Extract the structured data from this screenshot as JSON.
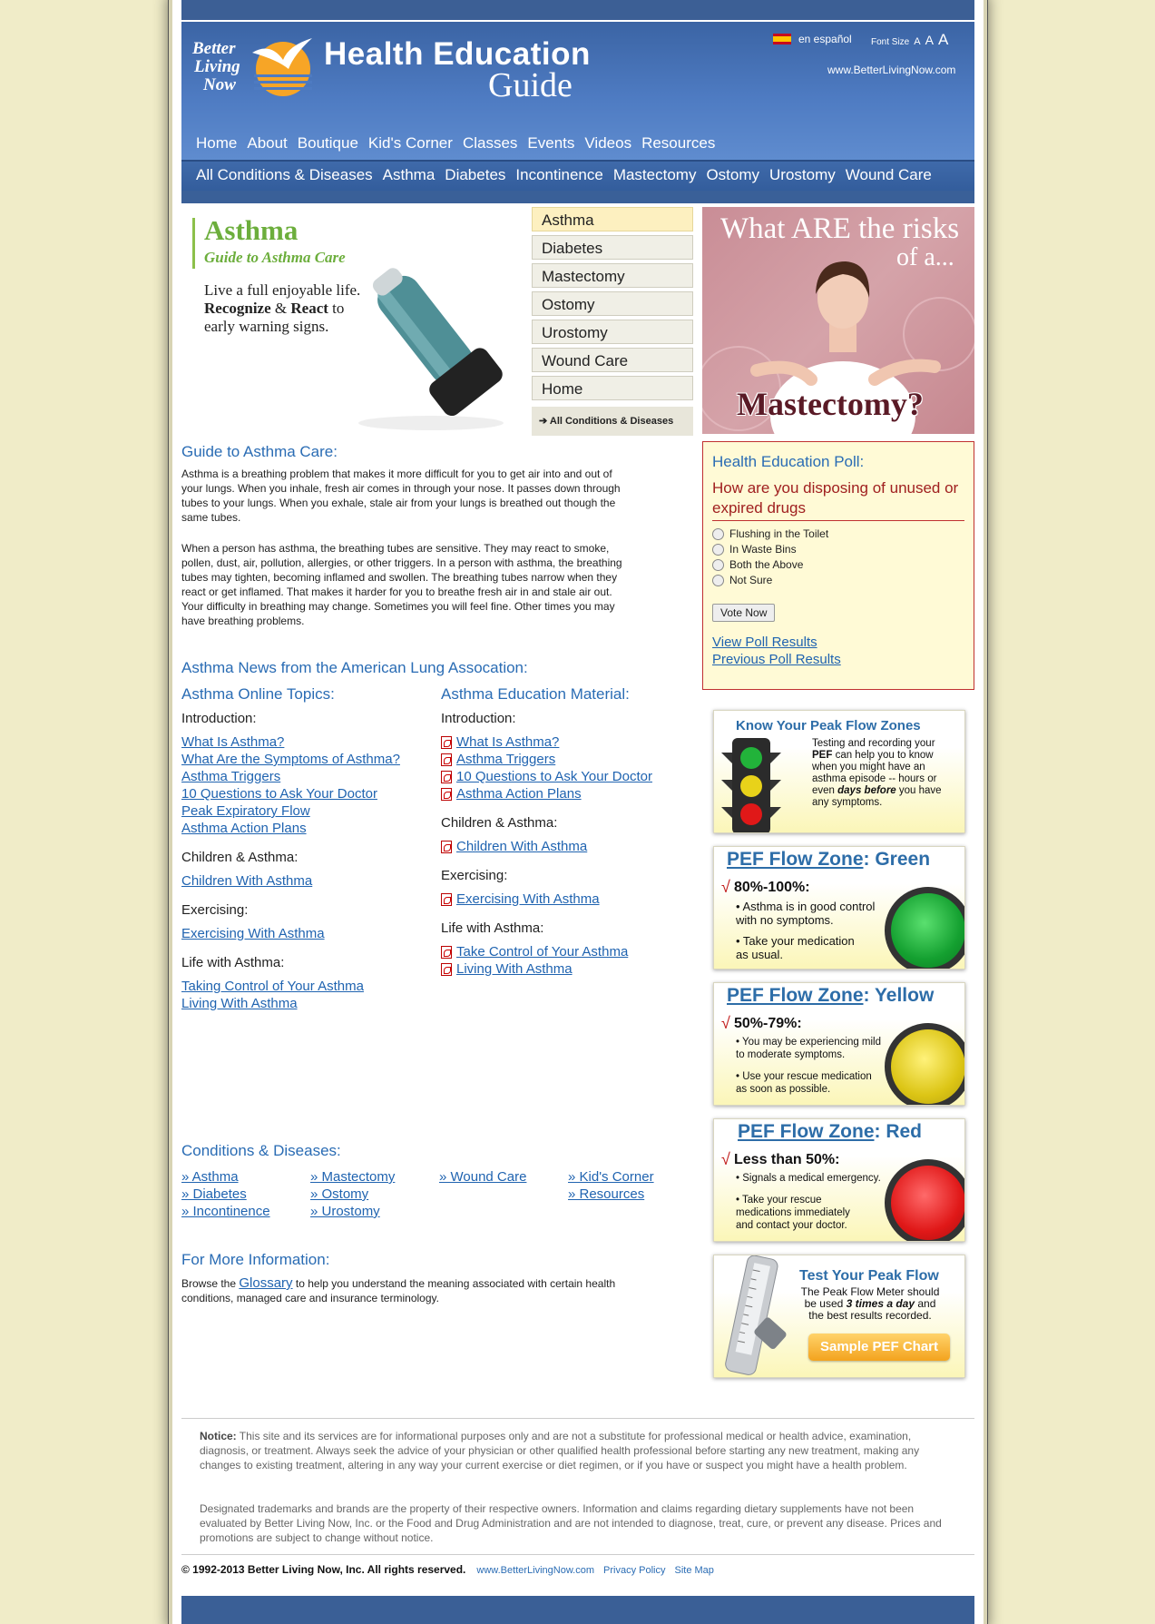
{
  "header": {
    "logo_text": [
      "Better",
      "Living",
      "Now"
    ],
    "title": "Health Education",
    "title_sub": "Guide",
    "language": "en español",
    "font_size_label": "Font Size",
    "font_size_options": [
      "A",
      "A",
      "A"
    ],
    "site_url": "www.BetterLivingNow.com"
  },
  "nav_main": [
    "Home",
    "About",
    "Boutique",
    "Kid's Corner",
    "Classes",
    "Events",
    "Videos",
    "Resources"
  ],
  "nav_conditions": [
    "All Conditions & Diseases",
    "Asthma",
    "Diabetes",
    "Incontinence",
    "Mastectomy",
    "Ostomy",
    "Urostomy",
    "Wound Care"
  ],
  "hero": {
    "title": "Asthma",
    "subtitle": "Guide to Asthma Care",
    "tagline_1": "Live a full enjoyable life.",
    "tagline_2_bold_a": "Recognize",
    "tagline_2_amp": " & ",
    "tagline_2_bold_b": "React",
    "tagline_2_rest": " to",
    "tagline_3": "early warning signs."
  },
  "side_nav": {
    "items": [
      "Asthma",
      "Diabetes",
      "Mastectomy",
      "Ostomy",
      "Urostomy",
      "Wound Care",
      "Home"
    ],
    "active": "Asthma",
    "all_link": "All Conditions & Diseases"
  },
  "ad_mastectomy": {
    "line1": "What ARE the risks",
    "line2": "of a...",
    "line3": "Mastectomy?"
  },
  "guide": {
    "heading": "Guide to Asthma Care:",
    "p1": "Asthma is a breathing problem that makes it more difficult for you to get air into and out of your lungs. When you inhale, fresh air comes in through your nose. It passes down through tubes to your lungs. When you exhale, stale air from your lungs is breathed out though the same tubes.",
    "p2": "When a person has asthma, the breathing tubes are sensitive. They may react to smoke, pollen, dust, air, pollution, allergies, or other triggers. In a person with asthma, the breathing tubes may tighten, becoming inflamed and swollen. The breathing tubes narrow when they react or get inflamed. That makes it harder for you to breathe fresh air in and stale air out. Your difficulty in breathing may change. Sometimes you will feel fine. Other times you may have breathing problems."
  },
  "news_heading": "Asthma News from the American Lung Assocation:",
  "topics": {
    "heading": "Asthma Online Topics:",
    "intro_label": "Introduction:",
    "intro_links": [
      "What Is Asthma?",
      "What Are the Symptoms of Asthma?",
      "Asthma Triggers",
      "10 Questions to Ask Your Doctor",
      "Peak Expiratory Flow",
      "Asthma Action Plans"
    ],
    "children_label": "Children & Asthma:",
    "children_links": [
      "Children With Asthma"
    ],
    "exercise_label": "Exercising:",
    "exercise_links": [
      "Exercising With Asthma"
    ],
    "life_label": "Life with Asthma:",
    "life_links": [
      "Taking Control of Your Asthma",
      "Living With Asthma"
    ]
  },
  "materials": {
    "heading": "Asthma Education Material:",
    "intro_label": "Introduction:",
    "intro_links": [
      "What Is Asthma?",
      "Asthma Triggers",
      "10 Questions to Ask Your Doctor",
      "Asthma Action Plans"
    ],
    "children_label": "Children & Asthma:",
    "children_links": [
      "Children With Asthma"
    ],
    "exercise_label": "Exercising:",
    "exercise_links": [
      "Exercising With Asthma"
    ],
    "life_label": "Life with Asthma:",
    "life_links": [
      "Take Control of Your Asthma",
      "Living With Asthma"
    ]
  },
  "conditions": {
    "heading": "Conditions & Diseases:",
    "links": [
      "» Asthma",
      "» Mastectomy",
      "» Wound Care",
      "» Kid's Corner",
      "» Diabetes",
      "» Ostomy",
      "",
      "» Resources",
      "» Incontinence",
      "» Urostomy",
      "",
      ""
    ]
  },
  "more_info": {
    "heading": "For More Information:",
    "pre": "Browse the ",
    "link": "Glossary",
    "post": " to help you understand the meaning associated with certain health conditions, managed care and insurance terminology."
  },
  "poll": {
    "heading": "Health Education Poll:",
    "question": "How are you disposing of unused or expired drugs",
    "options": [
      "Flushing in the Toilet",
      "In Waste Bins",
      "Both the Above",
      "Not Sure"
    ],
    "vote_label": "Vote Now",
    "results_link": "View Poll Results",
    "previous_link": "Previous Poll Results"
  },
  "peak_zones": {
    "title": "Know Your Peak Flow Zones",
    "text_pre": "Testing and recording your ",
    "text_bold": "PEF",
    "text_mid": " can help you to know when you might have an asthma episode -- hours or even ",
    "text_em": "days before",
    "text_post": " you have any symptoms."
  },
  "green_zone": {
    "title_a": "PEF Flow Zone",
    "title_b": ": Green",
    "range": "80%-100%:",
    "b1": "• Asthma is in good control with no symptoms.",
    "b2": "• Take your medication as usual.",
    "color": "#1fa33a"
  },
  "yellow_zone": {
    "title_a": "PEF Flow Zone",
    "title_b": ": Yellow",
    "range": "50%-79%:",
    "b1": "• You may be experiencing mild to moderate symptoms.",
    "b2": "• Use your rescue medication as soon as possible.",
    "color": "#e5cc10"
  },
  "red_zone": {
    "title_a": "PEF Flow Zone",
    "title_b": ": Red",
    "range": "Less than 50%:",
    "b1": "• Signals a medical emergency.",
    "b2": "• Take your rescue medications immediately and contact your doctor.",
    "color": "#e01818"
  },
  "test_peak": {
    "title": "Test Your Peak Flow",
    "text_pre": "The Peak Flow Meter should be used ",
    "text_em": "3 times a day",
    "text_post": " and the best results recorded.",
    "button": "Sample PEF Chart"
  },
  "footer": {
    "notice_label": "Notice:",
    "notice": " This site and its services are for informational purposes only and are not a substitute for professional medical or health advice, examination, diagnosis, or treatment. Always seek the advice of your physician or other qualified health professional before starting any new treatment, making any changes to existing treatment, altering in any way your current exercise or diet regimen, or if you have or suspect you might have a health problem.",
    "trademark": "Designated trademarks and brands are the property of their respective owners. Information and claims regarding dietary supplements have not been evaluated by Better Living Now, Inc. or the Food and Drug Administration and are not intended to diagnose, treat, cure, or prevent any disease. Prices and promotions are subject to change without notice.",
    "copyright": "© 1992-2013 Better Living Now, Inc. All rights reserved.",
    "links": [
      "www.BetterLivingNow.com",
      "Privacy Policy",
      "Site Map"
    ]
  }
}
